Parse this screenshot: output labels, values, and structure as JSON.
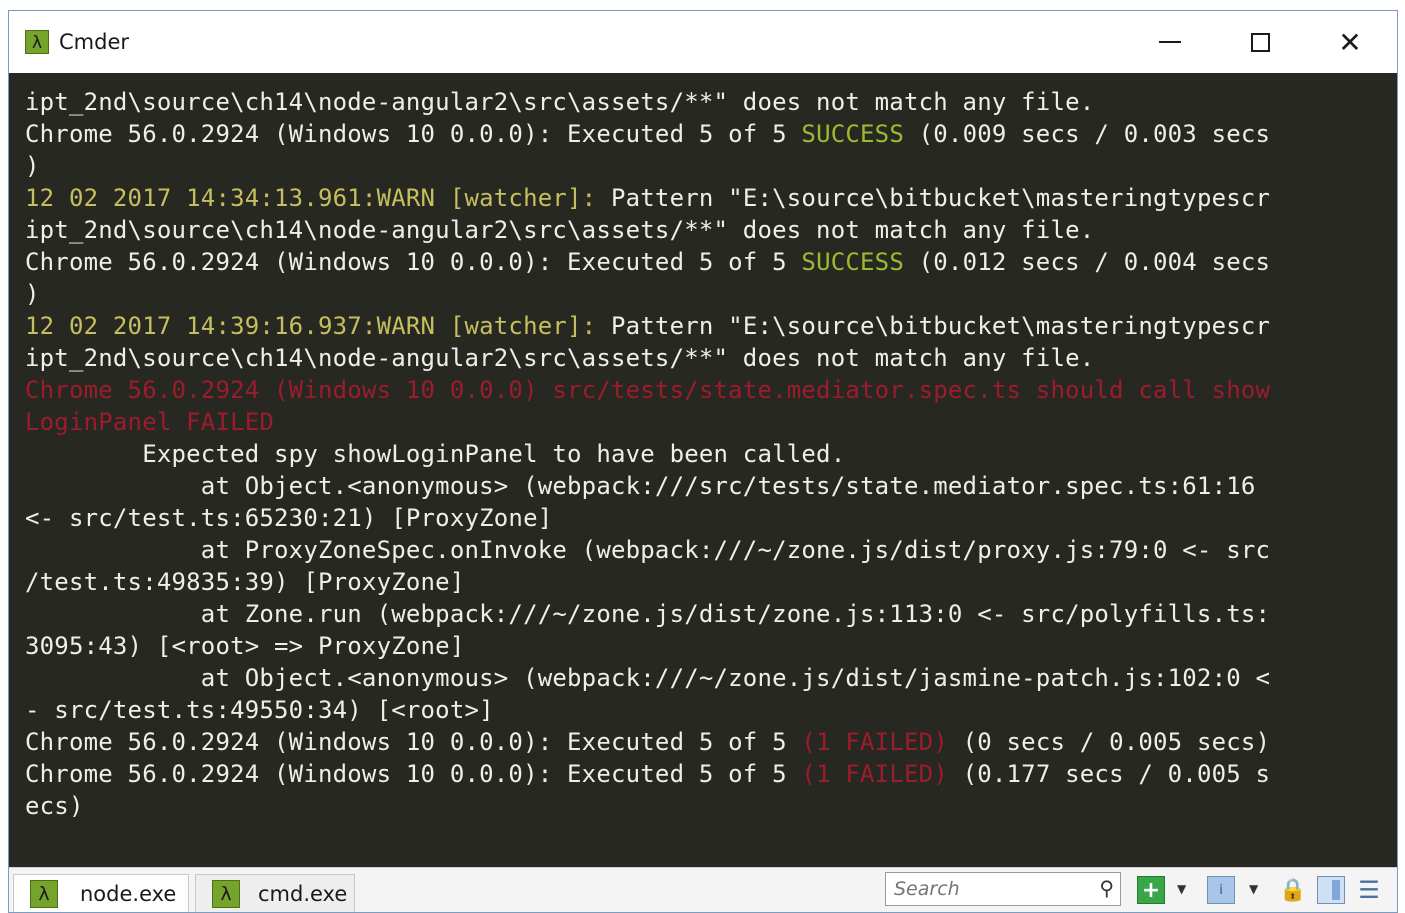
{
  "window": {
    "title": "Cmder",
    "icon_glyph": "λ",
    "controls": {
      "minimize": "",
      "maximize": "",
      "close": "✕"
    }
  },
  "console": {
    "colors": {
      "background": "#272822",
      "text": "#efefe8",
      "warn": "#c7bf5e",
      "success": "#9dbb2e",
      "failed": "#9c1c2b"
    },
    "lines": [
      [
        {
          "t": "ipt_2nd\\source\\ch14\\node-angular2\\src\\assets/**\" does not match any file.",
          "c": "white"
        }
      ],
      [
        {
          "t": "Chrome 56.0.2924 (Windows 10 0.0.0): Executed 5 of 5 ",
          "c": "white"
        },
        {
          "t": "SUCCESS",
          "c": "green"
        },
        {
          "t": " (0.009 secs / 0.003 secs",
          "c": "white"
        }
      ],
      [
        {
          "t": ")",
          "c": "white"
        }
      ],
      [
        {
          "t": "12 02 2017 14:34:13.961:WARN [watcher]:",
          "c": "yellow"
        },
        {
          "t": " Pattern \"E:\\source\\bitbucket\\masteringtypescr",
          "c": "white"
        }
      ],
      [
        {
          "t": "ipt_2nd\\source\\ch14\\node-angular2\\src\\assets/**\" does not match any file.",
          "c": "white"
        }
      ],
      [
        {
          "t": "Chrome 56.0.2924 (Windows 10 0.0.0): Executed 5 of 5 ",
          "c": "white"
        },
        {
          "t": "SUCCESS",
          "c": "green"
        },
        {
          "t": " (0.012 secs / 0.004 secs",
          "c": "white"
        }
      ],
      [
        {
          "t": ")",
          "c": "white"
        }
      ],
      [
        {
          "t": "12 02 2017 14:39:16.937:WARN [watcher]:",
          "c": "yellow"
        },
        {
          "t": " Pattern \"E:\\source\\bitbucket\\masteringtypescr",
          "c": "white"
        }
      ],
      [
        {
          "t": "ipt_2nd\\source\\ch14\\node-angular2\\src\\assets/**\" does not match any file.",
          "c": "white"
        }
      ],
      [
        {
          "t": "Chrome 56.0.2924 (Windows 10 0.0.0) src/tests/state.mediator.spec.ts should call show",
          "c": "red"
        }
      ],
      [
        {
          "t": "LoginPanel FAILED",
          "c": "red"
        }
      ],
      [
        {
          "t": "        Expected spy showLoginPanel to have been called.",
          "c": "white"
        }
      ],
      [
        {
          "t": "            at Object.<anonymous> (webpack:///src/tests/state.mediator.spec.ts:61:16",
          "c": "white"
        }
      ],
      [
        {
          "t": "<- src/test.ts:65230:21) [ProxyZone]",
          "c": "white"
        }
      ],
      [
        {
          "t": "            at ProxyZoneSpec.onInvoke (webpack:///~/zone.js/dist/proxy.js:79:0 <- src",
          "c": "white"
        }
      ],
      [
        {
          "t": "/test.ts:49835:39) [ProxyZone]",
          "c": "white"
        }
      ],
      [
        {
          "t": "            at Zone.run (webpack:///~/zone.js/dist/zone.js:113:0 <- src/polyfills.ts:",
          "c": "white"
        }
      ],
      [
        {
          "t": "3095:43) [<root> => ProxyZone]",
          "c": "white"
        }
      ],
      [
        {
          "t": "            at Object.<anonymous> (webpack:///~/zone.js/dist/jasmine-patch.js:102:0 <",
          "c": "white"
        }
      ],
      [
        {
          "t": "- src/test.ts:49550:34) [<root>]",
          "c": "white"
        }
      ],
      [
        {
          "t": "Chrome 56.0.2924 (Windows 10 0.0.0): Executed 5 of 5 ",
          "c": "white"
        },
        {
          "t": "(1 FAILED)",
          "c": "red"
        },
        {
          "t": " (0 secs / 0.005 secs)",
          "c": "white"
        }
      ],
      [
        {
          "t": "Chrome 56.0.2924 (Windows 10 0.0.0): Executed 5 of 5 ",
          "c": "white"
        },
        {
          "t": "(1 FAILED)",
          "c": "red"
        },
        {
          "t": " (0.177 secs / 0.005 s",
          "c": "white"
        }
      ],
      [
        {
          "t": "ecs)",
          "c": "white"
        }
      ]
    ]
  },
  "tabbar": {
    "tabs": [
      {
        "label": "node.exe",
        "icon_glyph": "λ"
      },
      {
        "label": "cmd.exe",
        "icon_glyph": "λ"
      }
    ],
    "search": {
      "placeholder": "Search",
      "icon": "search-icon"
    },
    "tools": {
      "new_console_icon": "plus-icon",
      "new_console_glyph": "+",
      "dropdown_glyph": "▼",
      "info_glyph": "i",
      "lock_glyph": "🔒",
      "menu_glyph": "☰"
    }
  }
}
